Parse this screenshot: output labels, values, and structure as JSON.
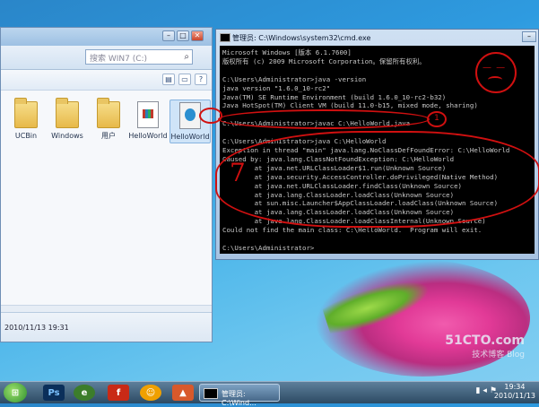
{
  "explorer": {
    "search_placeholder": "搜索 WIN7 (C:)",
    "items": [
      {
        "label": "UCBin",
        "icon": "folder-icon"
      },
      {
        "label": "Windows",
        "icon": "folder-icon"
      },
      {
        "label": "用户",
        "icon": "folder-icon"
      },
      {
        "label": "HelloWorld",
        "icon": "class-file-icon"
      },
      {
        "label": "HelloWorld",
        "icon": "java-file-icon"
      }
    ],
    "status_date": "2010/11/13 19:31"
  },
  "cmd": {
    "title": "管理员: C:\\Windows\\system32\\cmd.exe",
    "lines": [
      "Microsoft Windows [版本 6.1.7600]",
      "版权所有 (c) 2009 Microsoft Corporation。保留所有权利。",
      "",
      "C:\\Users\\Administrator>java -version",
      "java version \"1.6.0_10-rc2\"",
      "Java(TM) SE Runtime Environment (build 1.6.0_10-rc2-b32)",
      "Java HotSpot(TM) Client VM (build 11.0-b15, mixed mode, sharing)",
      "",
      "C:\\Users\\Administrator>javac C:\\HelloWorld.java",
      "",
      "C:\\Users\\Administrator>java C:\\HelloWorld",
      "Exception in thread \"main\" java.lang.NoClassDefFoundError: C:\\HelloWorld",
      "Caused by: java.lang.ClassNotFoundException: C:\\HelloWorld",
      "        at java.net.URLClassLoader$1.run(Unknown Source)",
      "        at java.security.AccessController.doPrivileged(Native Method)",
      "        at java.net.URLClassLoader.findClass(Unknown Source)",
      "        at java.lang.ClassLoader.loadClass(Unknown Source)",
      "        at sun.misc.Launcher$AppClassLoader.loadClass(Unknown Source)",
      "        at java.lang.ClassLoader.loadClass(Unknown Source)",
      "        at java.lang.ClassLoader.loadClassInternal(Unknown Source)",
      "Could not find the main class: C:\\HelloWorld.  Program will exit.",
      "",
      "C:\\Users\\Administrator>"
    ]
  },
  "annotations": {
    "num1": "1",
    "num2": "7"
  },
  "watermark": {
    "brand": "51CTO.com",
    "sub": "技术博客 Blog"
  },
  "taskbar": {
    "cmd_label": "管理员: C:\\Wind...",
    "time": "19:34",
    "date": "2010/11/13",
    "tray_icons": [
      "network-icon",
      "volume-icon",
      "flag-icon"
    ]
  },
  "colors": {
    "annotation_red": "#d01010",
    "console_bg": "#000000",
    "console_fg": "#c8c8c8"
  }
}
